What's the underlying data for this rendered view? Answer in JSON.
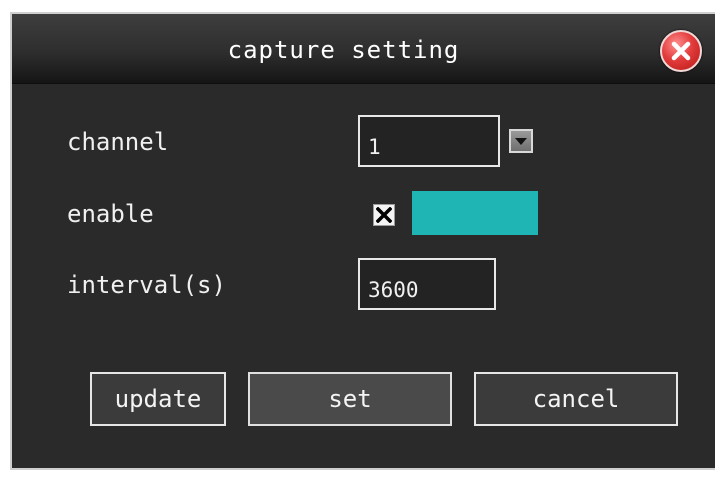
{
  "dialog": {
    "title": "capture setting",
    "close_icon": "close-icon"
  },
  "form": {
    "channel": {
      "label": "channel",
      "value": "1",
      "dropdown_icon": "chevron-down-icon"
    },
    "enable": {
      "label": "enable",
      "checked": true,
      "check_glyph": "x-mark",
      "swatch_color": "#1fb5b5"
    },
    "interval": {
      "label": "interval(s)",
      "value": "3600"
    }
  },
  "buttons": {
    "update": "update",
    "set": "set",
    "cancel": "cancel"
  },
  "colors": {
    "background": "#2a2a2a",
    "accent_swatch": "#1fb5b5",
    "close_button": "#e33c3c"
  }
}
